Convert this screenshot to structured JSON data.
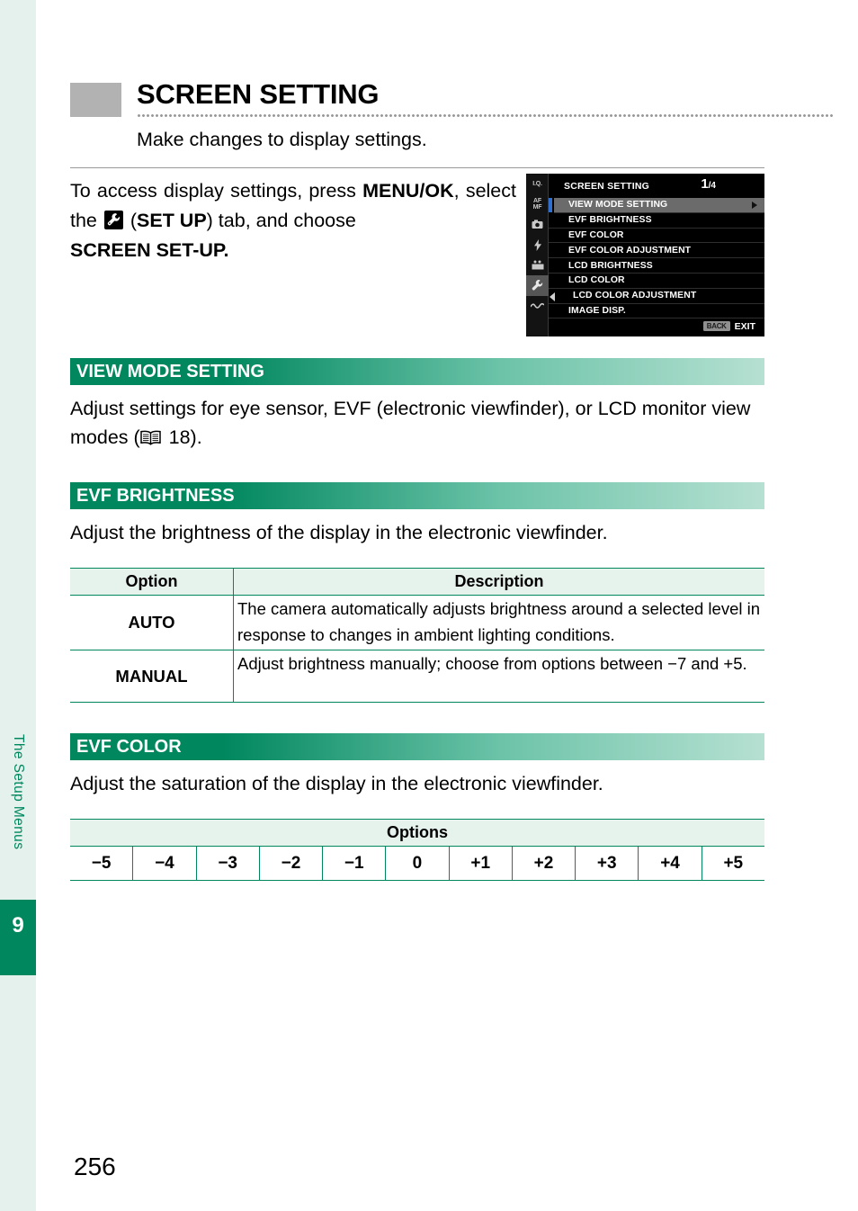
{
  "chapter": {
    "rail_label": "The Setup Menus",
    "number": "9"
  },
  "header": {
    "title": "SCREEN SETTING",
    "subtitle": "Make changes to display settings."
  },
  "intro": {
    "line1_a": "To access display settings, press ",
    "line1_b": "MENU/OK",
    "line1_c": ",",
    "line2_a": "select the ",
    "line2_icon": "wrench-icon",
    "line2_b": " (",
    "line2_c": "SET UP",
    "line2_d": ") tab, and choose",
    "line3": "SCREEN SET-UP."
  },
  "lcd": {
    "title": "SCREEN SETTING",
    "page_current": "1",
    "page_total": "/4",
    "tabs": [
      {
        "name": "image-quality-tab",
        "text": "I.Q.",
        "active": false
      },
      {
        "name": "autofocus-tab",
        "text": "AF\nMF",
        "active": false
      },
      {
        "name": "shooting-tab",
        "text": "",
        "active": false
      },
      {
        "name": "flash-tab",
        "text": "",
        "active": false
      },
      {
        "name": "movie-tab",
        "text": "",
        "active": false
      },
      {
        "name": "setup-tab",
        "text": "",
        "active": true
      },
      {
        "name": "my-menu-tab",
        "text": "",
        "active": false
      }
    ],
    "items": [
      {
        "label": "VIEW MODE SETTING",
        "selected": true,
        "has_arrow": true,
        "indented": false
      },
      {
        "label": "EVF BRIGHTNESS",
        "selected": false,
        "has_arrow": false,
        "indented": false
      },
      {
        "label": "EVF COLOR",
        "selected": false,
        "has_arrow": false,
        "indented": false
      },
      {
        "label": "EVF COLOR ADJUSTMENT",
        "selected": false,
        "has_arrow": false,
        "indented": false
      },
      {
        "label": "LCD BRIGHTNESS",
        "selected": false,
        "has_arrow": false,
        "indented": false
      },
      {
        "label": "LCD COLOR",
        "selected": false,
        "has_arrow": false,
        "indented": false
      },
      {
        "label": "LCD COLOR ADJUSTMENT",
        "selected": false,
        "has_arrow": false,
        "indented": true
      },
      {
        "label": "IMAGE DISP.",
        "selected": false,
        "has_arrow": false,
        "indented": false
      }
    ],
    "footer": {
      "back_chip": "BACK",
      "exit_label": "EXIT"
    }
  },
  "sections": [
    {
      "id": "view-mode-setting",
      "heading": "VIEW MODE SETTING",
      "body_part1": "Adjust settings for eye sensor, EVF (electronic viewfinder), or LCD monitor view modes (",
      "body_icon": "book-icon",
      "body_part2": " 18)."
    },
    {
      "id": "evf-brightness",
      "heading": "EVF BRIGHTNESS",
      "body": "Adjust the brightness of the display in the electronic viewfinder."
    },
    {
      "id": "evf-color",
      "heading": "EVF COLOR",
      "body": "Adjust the saturation of the display in the electronic viewfinder."
    }
  ],
  "brightness_table": {
    "col_option": "Option",
    "col_description": "Description",
    "rows": [
      {
        "option": "AUTO",
        "description": "The camera automatically adjusts brightness around a selected level in response to changes in ambient lighting conditions."
      },
      {
        "option": "MANUAL",
        "description": "Adjust brightness manually; choose from options between −7 and +5."
      }
    ]
  },
  "color_table": {
    "header": "Options",
    "values": [
      "−5",
      "−4",
      "−3",
      "−2",
      "−1",
      "0",
      "+1",
      "+2",
      "+3",
      "+4",
      "+5"
    ]
  },
  "page_number": "256",
  "colors": {
    "brand_green": "#00875e",
    "gradient_end": "#b6e0d2",
    "rail_bg": "#e4f1ec",
    "table_header_bg": "#e6f2ec",
    "title_swatch": "#b2b2b2"
  }
}
